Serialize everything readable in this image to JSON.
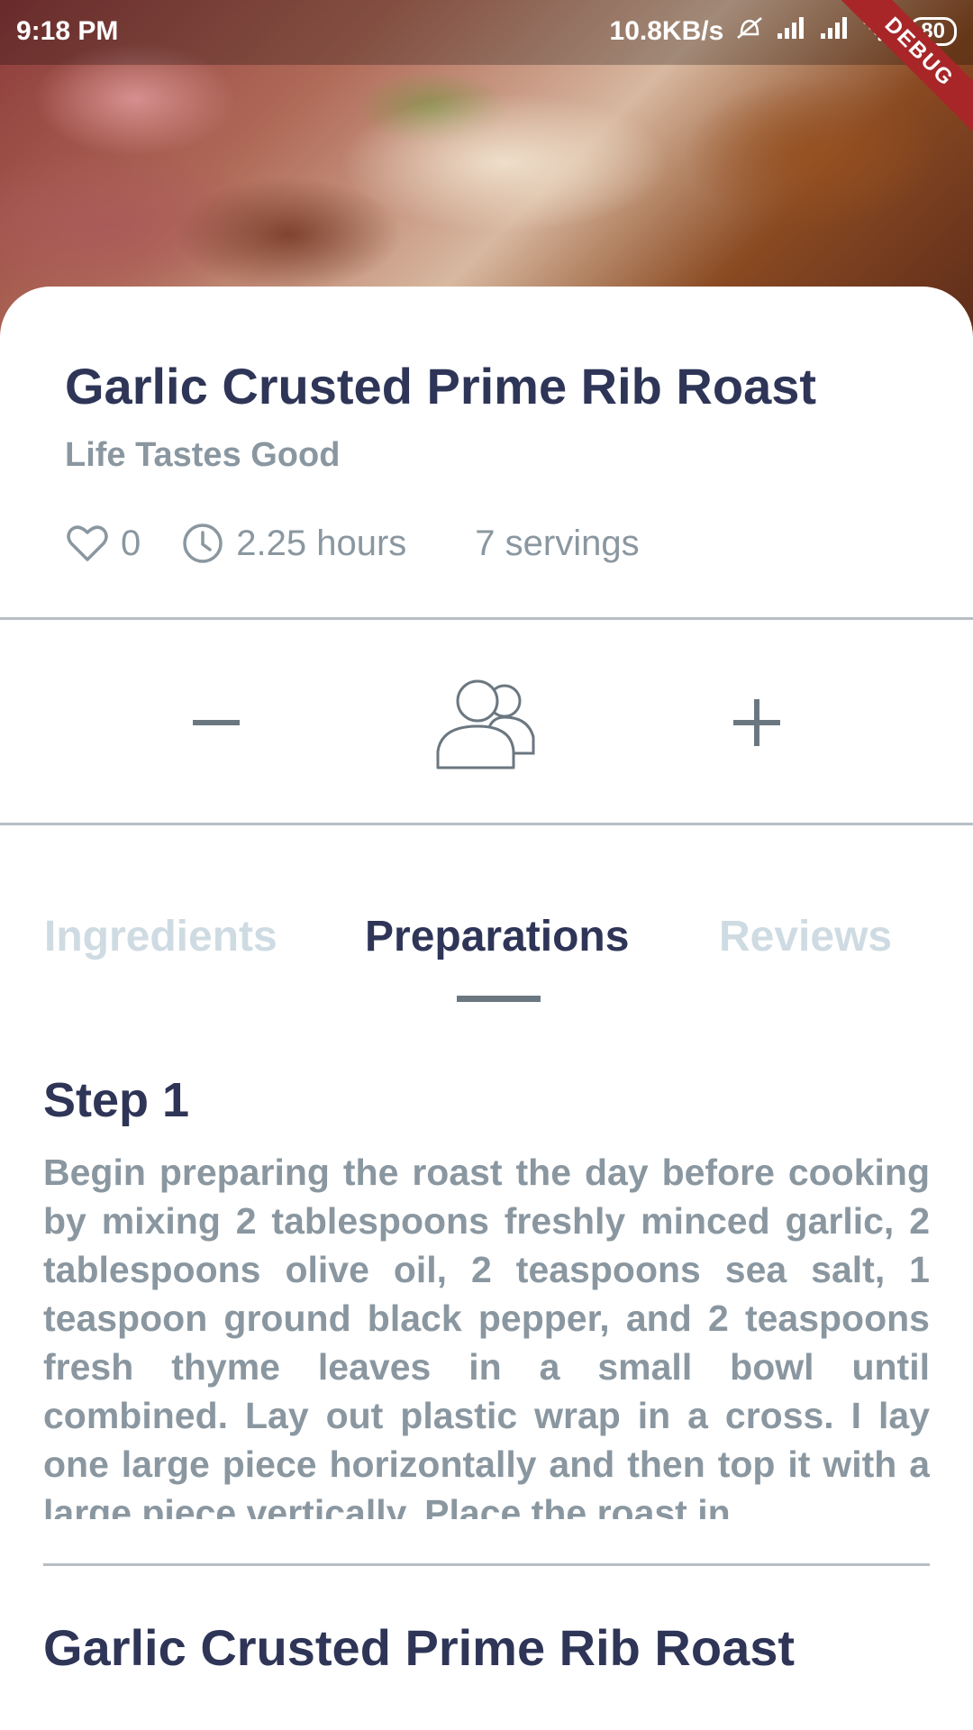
{
  "status_bar": {
    "time": "9:18 PM",
    "network_speed": "10.8KB/s",
    "battery": "80",
    "debug_label": "DEBUG"
  },
  "recipe": {
    "title": "Garlic Crusted Prime Rib Roast",
    "source": "Life Tastes Good",
    "likes": "0",
    "duration": "2.25 hours",
    "servings": "7 servings"
  },
  "icons": {
    "like": "heart-icon",
    "time": "clock-icon",
    "decrease": "minus-icon",
    "people": "people-icon",
    "increase": "plus-icon"
  },
  "tabs": [
    {
      "label": "Ingredients",
      "active": false
    },
    {
      "label": "Preparations",
      "active": true
    },
    {
      "label": "Reviews",
      "active": false
    }
  ],
  "steps": [
    {
      "title": "Step 1",
      "text": "Begin preparing the roast the day before cooking by mixing 2 tablespoons freshly minced garlic, 2 tablespoons olive oil, 2 teaspoons sea salt, 1 teaspoon ground black pepper, and 2 teaspoons fresh thyme leaves in a small bowl until combined. Lay out plastic wrap in a cross. I lay one large piece horizontally and then top it with a large piece vertically. Place the roast in"
    }
  ],
  "footer_title": "Garlic Crusted Prime Rib Roast",
  "colors": {
    "primary_text": "#2e3557",
    "secondary_text": "#8a97a0",
    "inactive_tab": "#cfdbe2",
    "divider": "#b7bfc5",
    "debug_banner": "#a82628"
  }
}
